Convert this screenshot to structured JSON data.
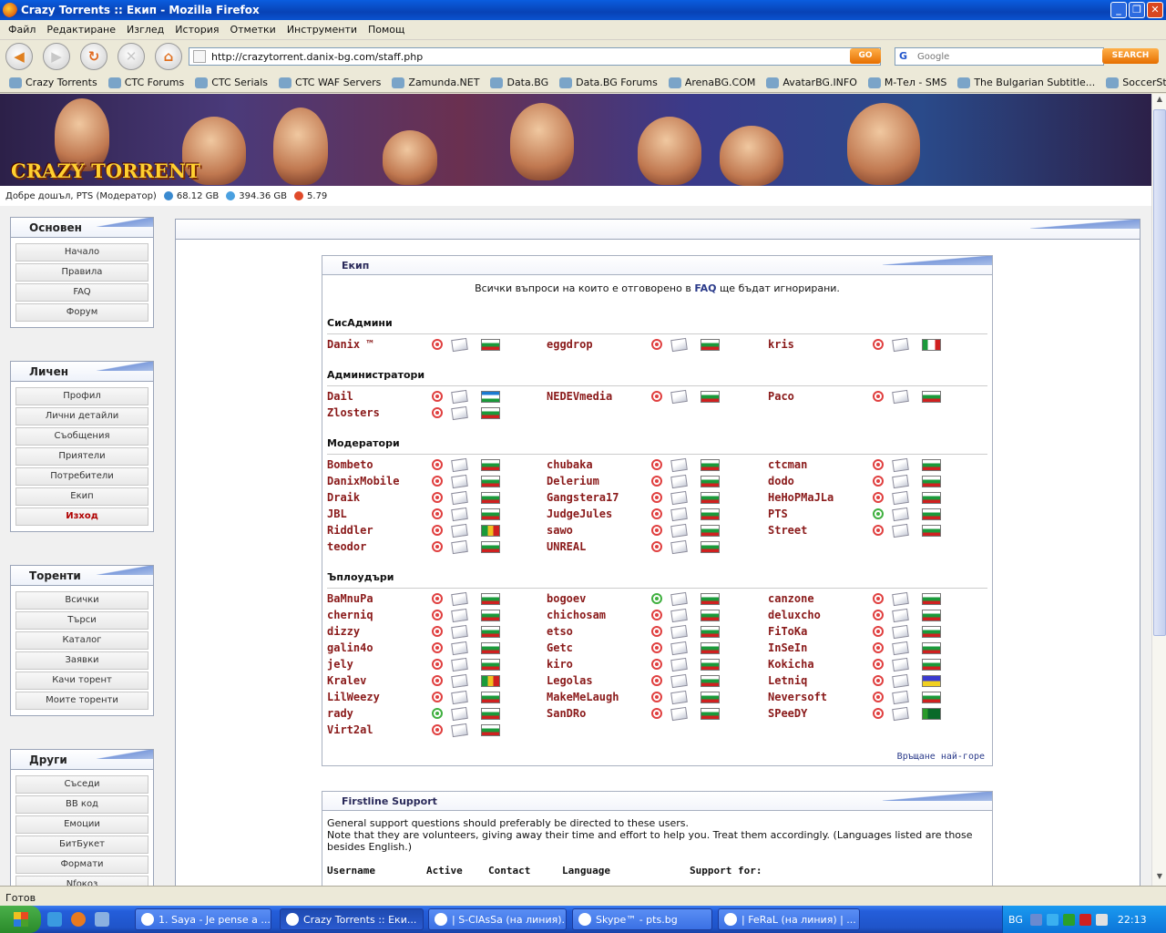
{
  "window": {
    "title": "Crazy Torrents :: Екип - Mozilla Firefox"
  },
  "menu": [
    "Файл",
    "Редактиране",
    "Изглед",
    "История",
    "Отметки",
    "Инструменти",
    "Помощ"
  ],
  "nav": {
    "url": "http://crazytorrent.danix-bg.com/staff.php",
    "go": "GO",
    "search_placeholder": "Google",
    "search_button": "SEARCH"
  },
  "bookmarks": [
    "Crazy Torrents",
    "CTC Forums",
    "CTC Serials",
    "CTC WAF Servers",
    "Zamunda.NET",
    "Data.BG",
    "Data.BG Forums",
    "ArenaBG.COM",
    "AvatarBG.INFO",
    "M-Тел - SMS",
    "The Bulgarian Subtitle...",
    "SoccerStand"
  ],
  "banner": {
    "logo": "CRAZY TORRENT"
  },
  "userline": {
    "welcome": "Добре дошъл, PTS (Модератор)",
    "upload": "68.12 GB",
    "download": "394.36 GB",
    "ratio": "5.79"
  },
  "sidebar": [
    {
      "title": "Основен",
      "items": [
        "Начало",
        "Правила",
        "FAQ",
        "Форум"
      ]
    },
    {
      "title": "Личен",
      "items": [
        "Профил",
        "Лични детайли",
        "Съобщения",
        "Приятели",
        "Потребители",
        "Екип",
        "Изход"
      ]
    },
    {
      "title": "Торенти",
      "items": [
        "Всички",
        "Търси",
        "Каталог",
        "Заявки",
        "Качи торент",
        "Моите торенти"
      ]
    },
    {
      "title": "Други",
      "items": [
        "Съседи",
        "BB код",
        "Емоции",
        "БитБукет",
        "Формати",
        "Nfoкоз"
      ]
    }
  ],
  "staff": {
    "title": "Екип",
    "note_pre": "Всички въпроси на които е отговорено в",
    "note_link": "FAQ",
    "note_post": "ще бъдат игнорирани.",
    "back_to_top": "Връщане най-горе",
    "groups": [
      {
        "name": "СисАдмини",
        "members": [
          [
            "Danix ™",
            0,
            0
          ],
          [
            "eggdrop",
            0,
            0
          ],
          [
            "kris",
            0,
            5
          ]
        ]
      },
      {
        "name": "Администратори",
        "members": [
          [
            "Dail",
            0,
            1
          ],
          [
            "NEDEVmedia",
            0,
            0
          ],
          [
            "Paco",
            0,
            0
          ],
          [
            "Zlosters",
            0,
            0
          ]
        ]
      },
      {
        "name": "Модератори",
        "members": [
          [
            "Bombeto",
            0,
            0
          ],
          [
            "chubaka",
            0,
            0
          ],
          [
            "ctcman",
            0,
            0
          ],
          [
            "DanixMobile",
            0,
            0
          ],
          [
            "Delerium",
            0,
            0
          ],
          [
            "dodo",
            0,
            0
          ],
          [
            "Draik",
            0,
            0
          ],
          [
            "Gangstera17",
            0,
            0
          ],
          [
            "HeHoPMaJLa",
            0,
            0
          ],
          [
            "JBL",
            0,
            0
          ],
          [
            "JudgeJules",
            0,
            0
          ],
          [
            "PTS",
            1,
            0
          ],
          [
            "Riddler",
            0,
            2
          ],
          [
            "sawo",
            0,
            0
          ],
          [
            "Street",
            0,
            0
          ],
          [
            "teodor",
            0,
            0
          ],
          [
            "UNREAL",
            0,
            0
          ]
        ]
      },
      {
        "name": "Ъплоудъри",
        "members": [
          [
            "BaMnuPa",
            0,
            0
          ],
          [
            "bogoev",
            1,
            0
          ],
          [
            "canzone",
            0,
            0
          ],
          [
            "cherniq",
            0,
            0
          ],
          [
            "chichosam",
            0,
            0
          ],
          [
            "deluxcho",
            0,
            0
          ],
          [
            "dizzy",
            0,
            0
          ],
          [
            "etso",
            0,
            0
          ],
          [
            "FiToKa",
            0,
            0
          ],
          [
            "galin4o",
            0,
            0
          ],
          [
            "Getc",
            0,
            0
          ],
          [
            "InSeIn",
            0,
            0
          ],
          [
            "jely",
            0,
            0
          ],
          [
            "kiro",
            0,
            0
          ],
          [
            "Kokicha",
            0,
            0
          ],
          [
            "Kralev",
            0,
            2
          ],
          [
            "Legolas",
            0,
            0
          ],
          [
            "Letniq",
            0,
            3
          ],
          [
            "LilWeezy",
            0,
            0
          ],
          [
            "MakeMeLaugh",
            0,
            0
          ],
          [
            "Neversoft",
            0,
            0
          ],
          [
            "rady",
            1,
            0
          ],
          [
            "SanDRo",
            0,
            0
          ],
          [
            "SPeeDY",
            0,
            4
          ],
          [
            "Virt2al",
            0,
            0
          ]
        ]
      }
    ]
  },
  "firstline": {
    "title": "Firstline Support",
    "line1": "General support questions should preferably be directed to these users.",
    "line2": "Note that they are volunteers, giving away their time and effort to help you. Treat them accordingly. (Languages listed are those besides English.)",
    "headers": [
      "Username",
      "Active",
      "Contact",
      "Language",
      "Support for:"
    ]
  },
  "status": "Готов",
  "taskbar": {
    "tasks": [
      "1. Saya - Je pense a ...",
      "Crazy Torrents :: Еки...",
      "| S-ClAsSa (на линия)...",
      "Skype™ - pts.bg",
      "| FeRaL (на линия) | ..."
    ],
    "lang": "BG",
    "clock": "22:13"
  }
}
